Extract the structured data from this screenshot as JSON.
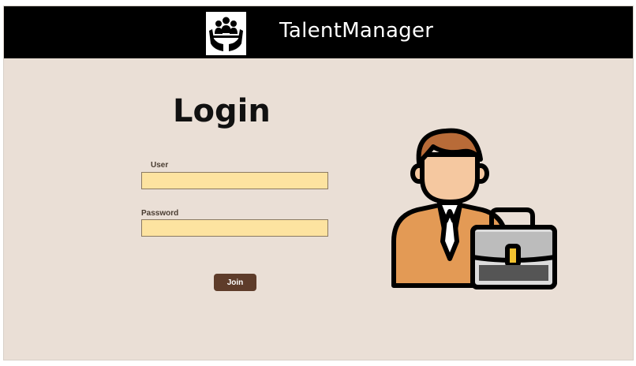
{
  "header": {
    "app_title": "TalentManager",
    "logo_icon": "team-care-hands-icon"
  },
  "login": {
    "title": "Login",
    "user_label": "User",
    "user_value": "",
    "password_label": "Password",
    "password_value": "",
    "join_label": "Join"
  },
  "illustration": {
    "icon": "businessman-with-briefcase-icon"
  },
  "colors": {
    "background": "#eadfd6",
    "header": "#000000",
    "input_fill": "#fde3a0",
    "button": "#5e3c2a"
  }
}
